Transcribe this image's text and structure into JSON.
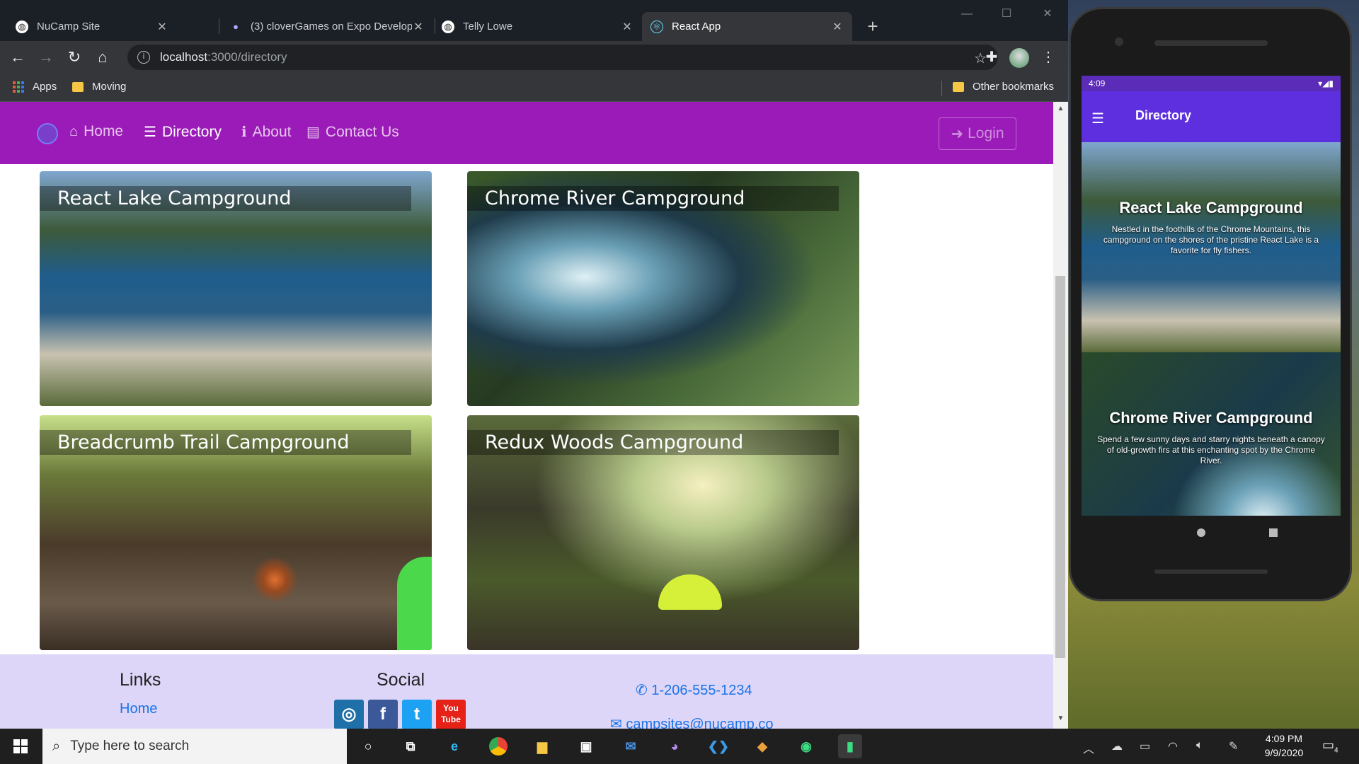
{
  "browser": {
    "tabs": [
      {
        "title": "NuCamp Site",
        "active": false
      },
      {
        "title": "(3) cloverGames on Expo Develop",
        "active": false
      },
      {
        "title": "Telly Lowe",
        "active": false
      },
      {
        "title": "React App",
        "active": true
      }
    ],
    "new_tab": "+",
    "address": {
      "host": "localhost",
      "path": ":3000/directory"
    },
    "bookmarks": {
      "apps": "Apps",
      "moving": "Moving",
      "other": "Other bookmarks"
    }
  },
  "site": {
    "nav": {
      "home": "Home",
      "directory": "Directory",
      "about": "About",
      "contact": "Contact Us",
      "login": "Login"
    },
    "campsites": [
      {
        "name": "React Lake Campground"
      },
      {
        "name": "Chrome River Campground"
      },
      {
        "name": "Breadcrumb Trail Campground"
      },
      {
        "name": "Redux Woods Campground"
      }
    ],
    "footer": {
      "links_title": "Links",
      "links": [
        "Home"
      ],
      "social_title": "Social",
      "social": {
        "instagram": "◎",
        "facebook": "f",
        "twitter": "t",
        "youtube": "You Tube"
      },
      "phone": "1-206-555-1234",
      "email": "campsites@nucamp.co"
    }
  },
  "phone_app": {
    "status_time": "4:09",
    "header_title": "Directory",
    "cards": [
      {
        "name": "React Lake Campground",
        "description": "Nestled in the foothills of the Chrome Mountains, this campground on the shores of the pristine React Lake is a favorite for fly fishers."
      },
      {
        "name": "Chrome River Campground",
        "description": "Spend a few sunny days and starry nights beneath a canopy of old-growth firs at this enchanting spot by the Chrome River."
      }
    ]
  },
  "taskbar": {
    "search_placeholder": "Type here to search",
    "time": "4:09 PM",
    "date": "9/9/2020",
    "notification_count": "4"
  }
}
